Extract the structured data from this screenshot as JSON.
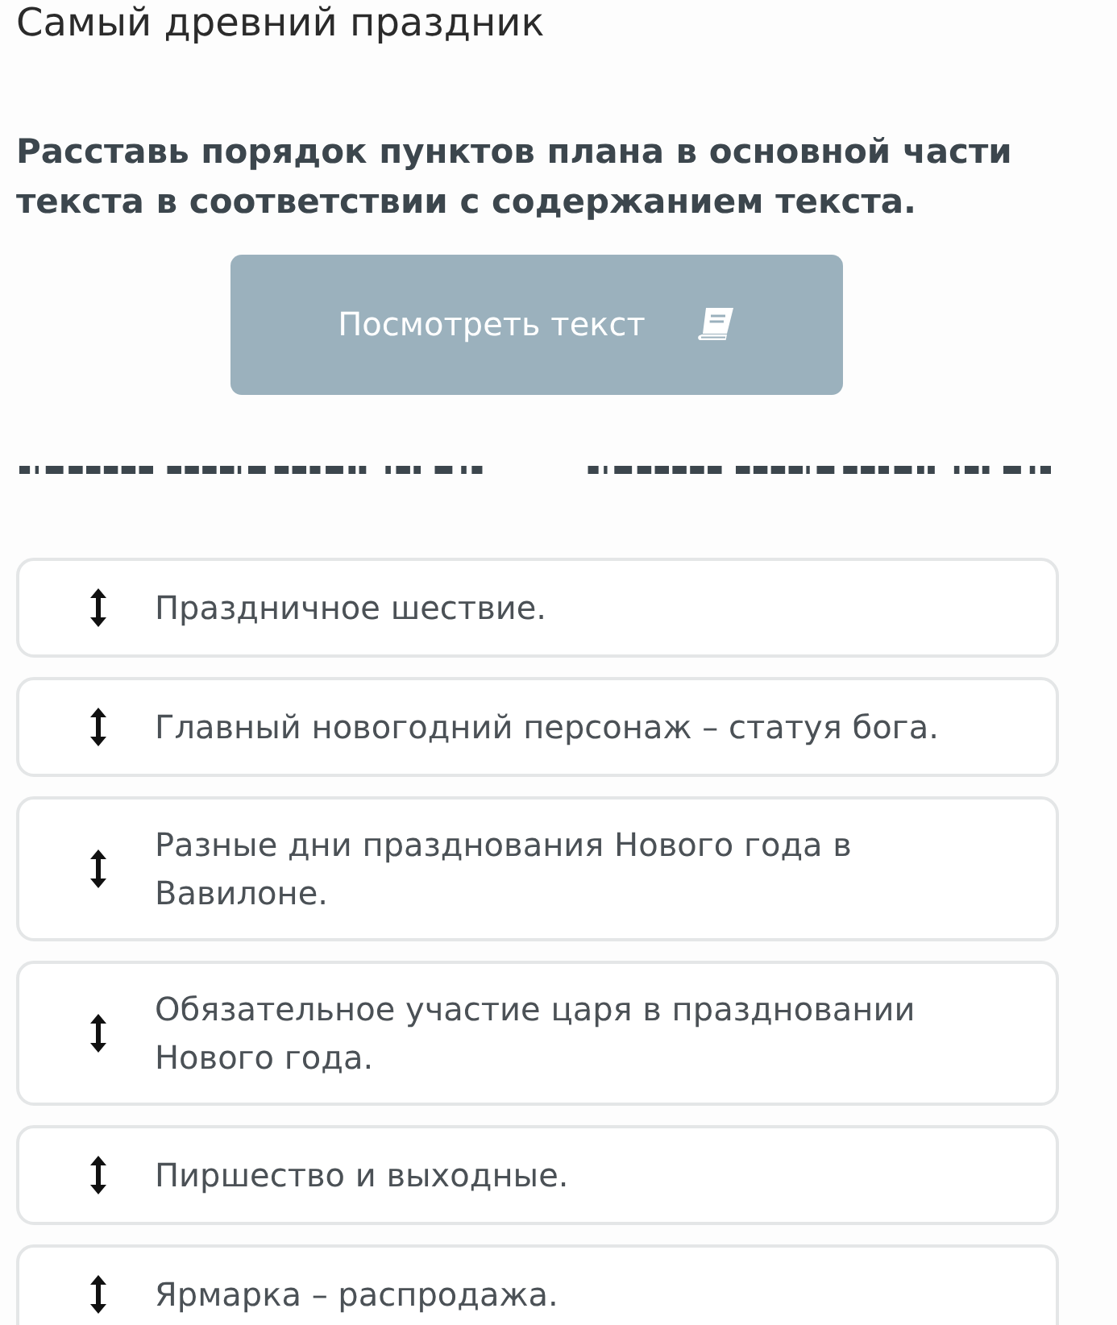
{
  "page": {
    "title": "Самый древний праздник"
  },
  "task": {
    "instruction": "Расставь порядок пунктов плана в основной части текста в соответствии с содержанием текста."
  },
  "view_text_button": {
    "label": "Посмотреть текст"
  },
  "plan_items": [
    {
      "text": "Праздничное шествие."
    },
    {
      "text": "Главный новогодний персонаж – статуя бога."
    },
    {
      "text": "Разные дни празднования Нового года в Вавилоне."
    },
    {
      "text": "Обязательное участие царя в праздновании Нового года."
    },
    {
      "text": "Пиршество и выходные."
    },
    {
      "text": "Ярмарка – распродажа."
    }
  ]
}
